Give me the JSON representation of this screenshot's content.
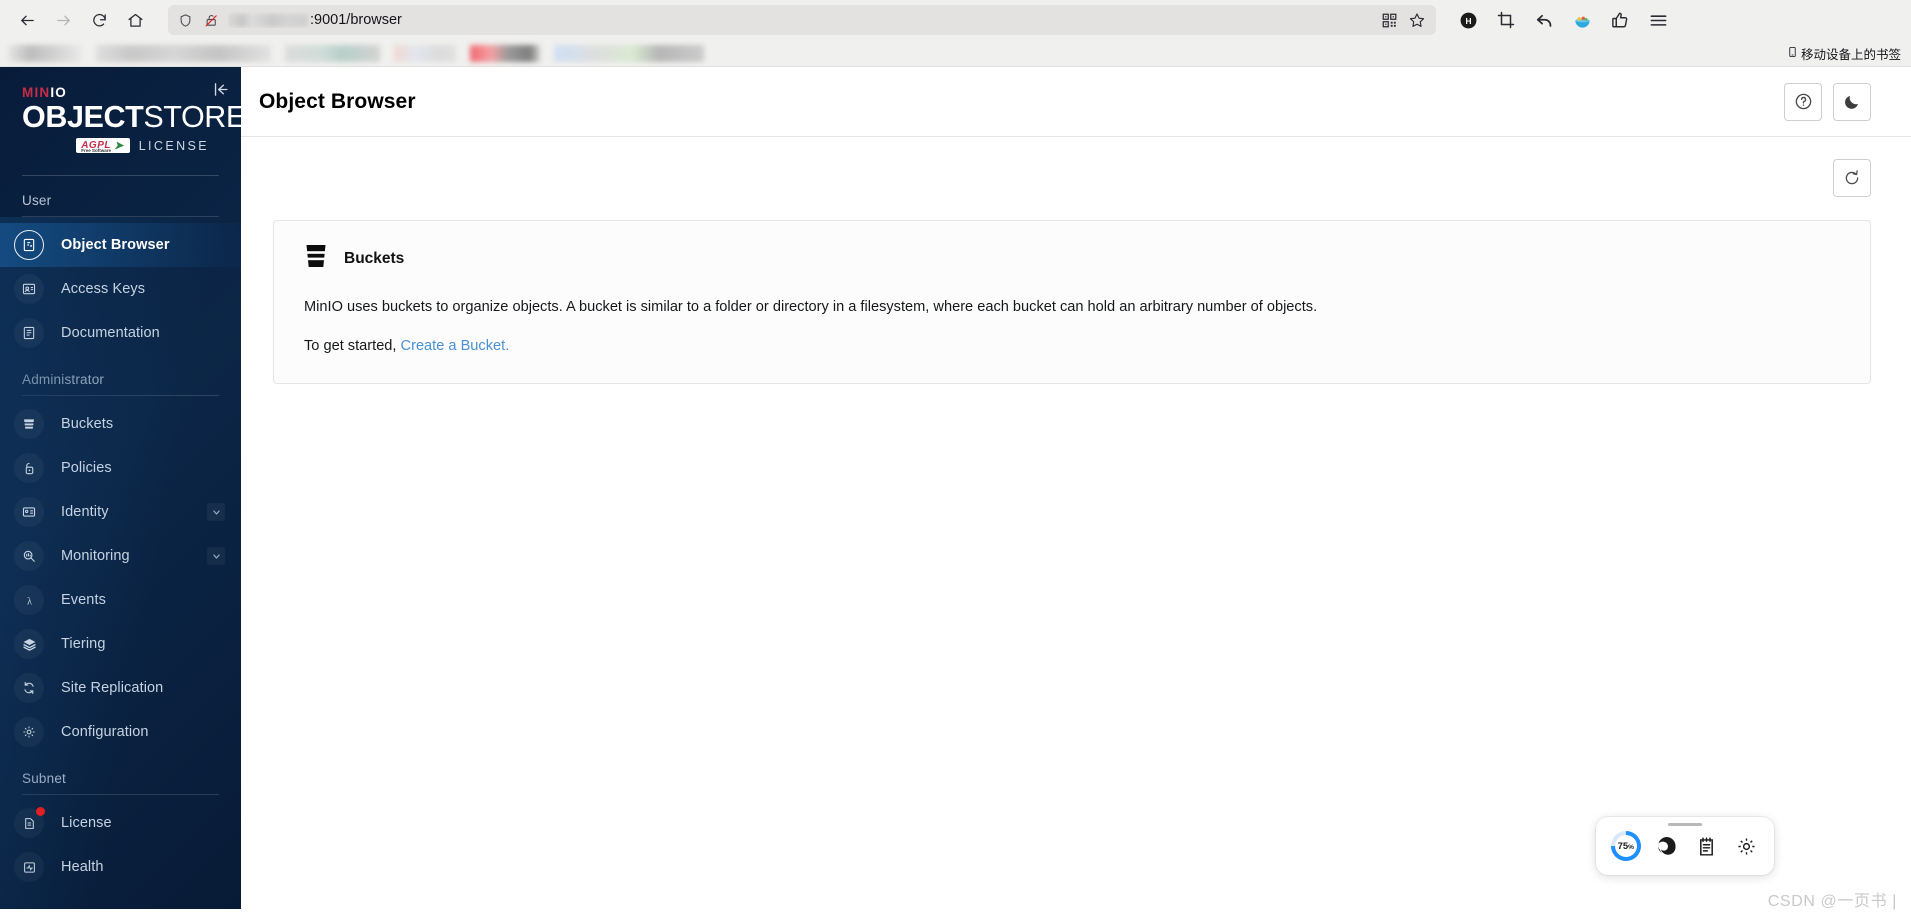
{
  "browser": {
    "nav": {
      "back": "back-arrow",
      "forward": "forward-arrow",
      "reload": "reload",
      "home": "home"
    },
    "url": {
      "host_redacted": "",
      "visible_text": ":9001/browser",
      "shield_icon": "shield-icon",
      "lock_broken_icon": "lock-broken-icon",
      "qr_icon": "qr-code-icon",
      "bookmark_star_icon": "star-icon"
    },
    "extensions": [
      {
        "name": "honey-extension",
        "glyph": "H"
      },
      {
        "name": "crop-capture-extension",
        "glyph": "crop"
      },
      {
        "name": "undo-extension",
        "glyph": "undo"
      },
      {
        "name": "bowl-extension",
        "glyph": "bowl"
      },
      {
        "name": "thumbs-up-extension",
        "glyph": "thumb"
      },
      {
        "name": "menu-button",
        "glyph": "hamburger"
      }
    ],
    "bookmarks_bar": {
      "mobile_bookmarks_label": "移动设备上的书签",
      "items_redacted": 6
    }
  },
  "sidebar": {
    "logo": {
      "brand_prefix": "MIN",
      "brand_suffix": "IO",
      "product_bold": "OBJECT",
      "product_light": "STORE",
      "license_badge": "AGPL",
      "license_badge_sub": "Free Software",
      "license_word": "LICENSE"
    },
    "collapse_label": "|←",
    "sections": [
      {
        "label": "User",
        "items": [
          {
            "label": "Object Browser",
            "icon": "object-browser-icon",
            "active": true,
            "chevron": false,
            "badge": false
          },
          {
            "label": "Access Keys",
            "icon": "access-keys-icon",
            "active": false,
            "chevron": false,
            "badge": false
          },
          {
            "label": "Documentation",
            "icon": "documentation-icon",
            "active": false,
            "chevron": false,
            "badge": false
          }
        ]
      },
      {
        "label": "Administrator",
        "items": [
          {
            "label": "Buckets",
            "icon": "bucket-icon",
            "active": false,
            "chevron": false,
            "badge": false
          },
          {
            "label": "Policies",
            "icon": "policies-lock-icon",
            "active": false,
            "chevron": false,
            "badge": false
          },
          {
            "label": "Identity",
            "icon": "identity-card-icon",
            "active": false,
            "chevron": true,
            "badge": false
          },
          {
            "label": "Monitoring",
            "icon": "monitoring-magnifier-icon",
            "active": false,
            "chevron": true,
            "badge": false
          },
          {
            "label": "Events",
            "icon": "events-lambda-icon",
            "active": false,
            "chevron": false,
            "badge": false
          },
          {
            "label": "Tiering",
            "icon": "tiering-layers-icon",
            "active": false,
            "chevron": false,
            "badge": false
          },
          {
            "label": "Site Replication",
            "icon": "site-replication-sync-icon",
            "active": false,
            "chevron": false,
            "badge": false
          },
          {
            "label": "Configuration",
            "icon": "configuration-gear-icon",
            "active": false,
            "chevron": false,
            "badge": false
          }
        ]
      },
      {
        "label": "Subnet",
        "items": [
          {
            "label": "License",
            "icon": "license-document-icon",
            "active": false,
            "chevron": false,
            "badge": true
          },
          {
            "label": "Health",
            "icon": "health-monitor-icon",
            "active": false,
            "chevron": false,
            "badge": false
          }
        ]
      }
    ]
  },
  "header": {
    "title": "Object Browser",
    "help_button": "help-icon",
    "dark_mode_button": "moon-icon"
  },
  "content": {
    "refresh_button": "refresh-icon",
    "panel": {
      "icon": "bucket-icon",
      "title": "Buckets",
      "description": "MinIO uses buckets to organize objects. A bucket is similar to a folder or directory in a filesystem, where each bucket can hold an arbitrary number of objects.",
      "cta_prefix": "To get started, ",
      "cta_link": "Create a Bucket.",
      "link_color": "#4a8fd4"
    }
  },
  "float_widget": {
    "progress_value": "75",
    "progress_unit": "%",
    "accent_color": "#1e90ff",
    "buttons": [
      {
        "name": "edge-swirl-icon"
      },
      {
        "name": "notepad-icon"
      },
      {
        "name": "settings-gear-icon"
      }
    ]
  },
  "watermark": "CSDN @一页书 |"
}
